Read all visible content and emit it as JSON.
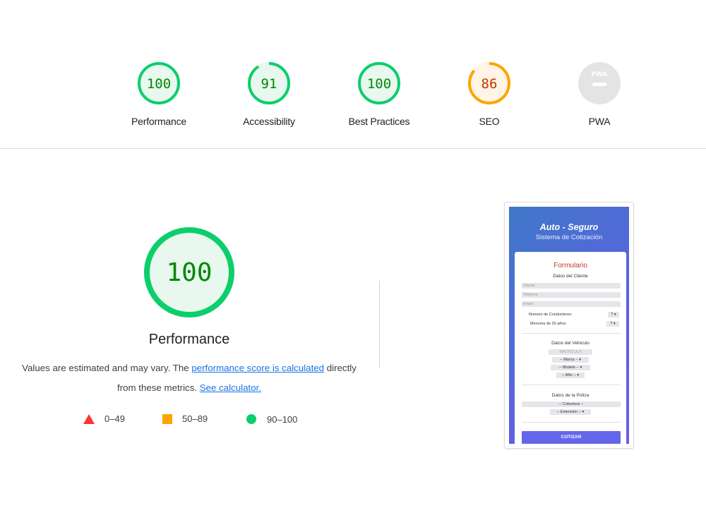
{
  "categories": [
    {
      "score": "100",
      "label": "Performance",
      "fraction": 1.0,
      "color": "#0cce6b",
      "bg": "#e8f8ee",
      "text_color": "#008800"
    },
    {
      "score": "91",
      "label": "Accessibility",
      "fraction": 0.91,
      "color": "#0cce6b",
      "bg": "#e8f8ee",
      "text_color": "#008800"
    },
    {
      "score": "100",
      "label": "Best Practices",
      "fraction": 1.0,
      "color": "#0cce6b",
      "bg": "#e8f8ee",
      "text_color": "#008800"
    },
    {
      "score": "86",
      "label": "SEO",
      "fraction": 0.86,
      "color": "#ffa400",
      "bg": "#fff4e5",
      "text_color": "#c33300"
    },
    {
      "score": "PWA",
      "label": "PWA",
      "fraction": 0,
      "color": "#cccccc",
      "bg": "#e4e4e4",
      "text_color": "#ffffff"
    }
  ],
  "main": {
    "score": "100",
    "title": "Performance",
    "desc_prefix": "Values are estimated and may vary. The ",
    "desc_link1": "performance score is calculated",
    "desc_middle": " directly from these metrics. ",
    "desc_link2": "See calculator."
  },
  "legend": [
    {
      "range": "0–49",
      "shape": "triangle-icon",
      "color": "#ff3333"
    },
    {
      "range": "50–89",
      "shape": "square-icon",
      "color": "#ffa400"
    },
    {
      "range": "90–100",
      "shape": "circle-icon",
      "color": "#0cce6b"
    }
  ],
  "screenshot": {
    "title": "Auto - Seguro",
    "subtitle": "Sistema de Cotización",
    "form_title": "Formulario",
    "client_section": "Datos del Cliente",
    "client_placeholder": "Cliente",
    "phone_placeholder": "Telefono",
    "email_placeholder": "Email",
    "drivers_label": "Numero de Conductores:",
    "drivers_value": "? ▾",
    "under25_label": "Menores de 25 años:",
    "under25_value": "? ▾",
    "vehicle_section": "Datos del Vehiculo",
    "plate_placeholder": "MATRICULA",
    "brand_select": "-- Marca --  ▾",
    "model_select": "-- Modelo --  ▾",
    "year_select": "-- Año --  ▾",
    "policy_section": "Datos de la Poliza",
    "coverage_select": "-- Cobertura --",
    "extension_select": "-- Extensión --  ▾",
    "submit_label": "COTIZAR"
  }
}
